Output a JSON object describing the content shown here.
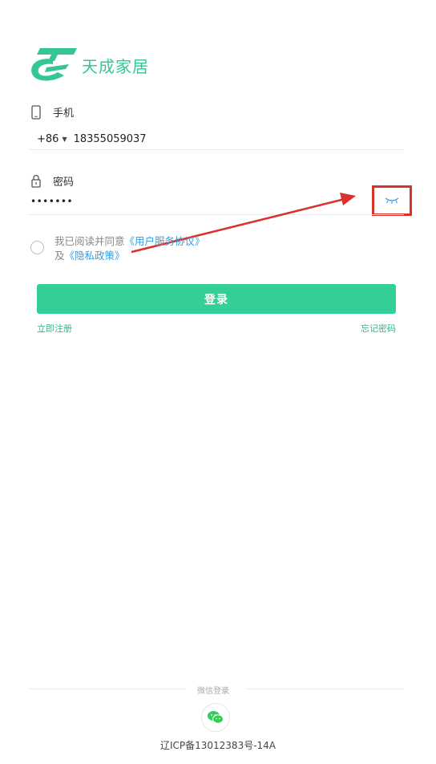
{
  "brand": {
    "name": "天成家居",
    "color": "#34c795"
  },
  "phone": {
    "label": "手机",
    "country_code": "+86",
    "number": "18355059037",
    "icon": "phone-icon"
  },
  "password": {
    "label": "密码",
    "masked_value": "•••••••",
    "icon": "lock-icon",
    "toggle_icon": "eye-closed-icon"
  },
  "agreement": {
    "prefix": "我已阅读并同意",
    "user_agreement": "《用户服务协议》",
    "and": "及",
    "privacy_policy": "《隐私政策》",
    "checked": false
  },
  "login_button": "登录",
  "register_link": "立即注册",
  "forgot_link": "忘记密码",
  "wechat": {
    "label": "微信登录",
    "icon": "wechat-icon"
  },
  "icp": "辽ICP备13012383号-14A",
  "colors": {
    "accent": "#34cf96",
    "link": "#3a9de0",
    "highlight": "#d8322a"
  }
}
